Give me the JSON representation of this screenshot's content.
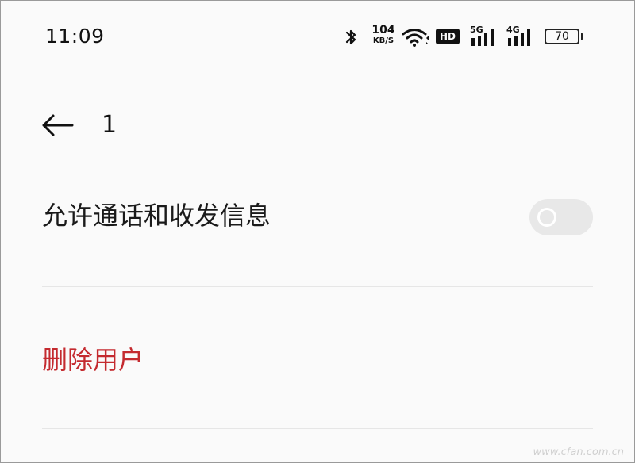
{
  "status_bar": {
    "time": "11:09",
    "net_speed_value": "104",
    "net_speed_unit": "KB/S",
    "hd_label": "HD",
    "sim1_label": "5G",
    "sim2_label": "4G",
    "battery_level": "70",
    "icons": [
      "bluetooth-icon",
      "wifi-icon",
      "hd-voice-icon",
      "signal-5g-icon",
      "signal-4g-icon",
      "battery-icon"
    ]
  },
  "header": {
    "title": "1",
    "back_icon": "arrow-left-icon"
  },
  "settings": {
    "allow_calls_sms_label": "允许通话和收发信息",
    "allow_calls_sms_enabled": false,
    "delete_user_label": "删除用户"
  },
  "colors": {
    "background": "#fafafa",
    "text": "#1a1a1a",
    "danger": "#c42a2f",
    "toggle_off": "#e8e8e8",
    "divider": "#e6e6e6"
  },
  "watermark": "www.cfan.com.cn"
}
